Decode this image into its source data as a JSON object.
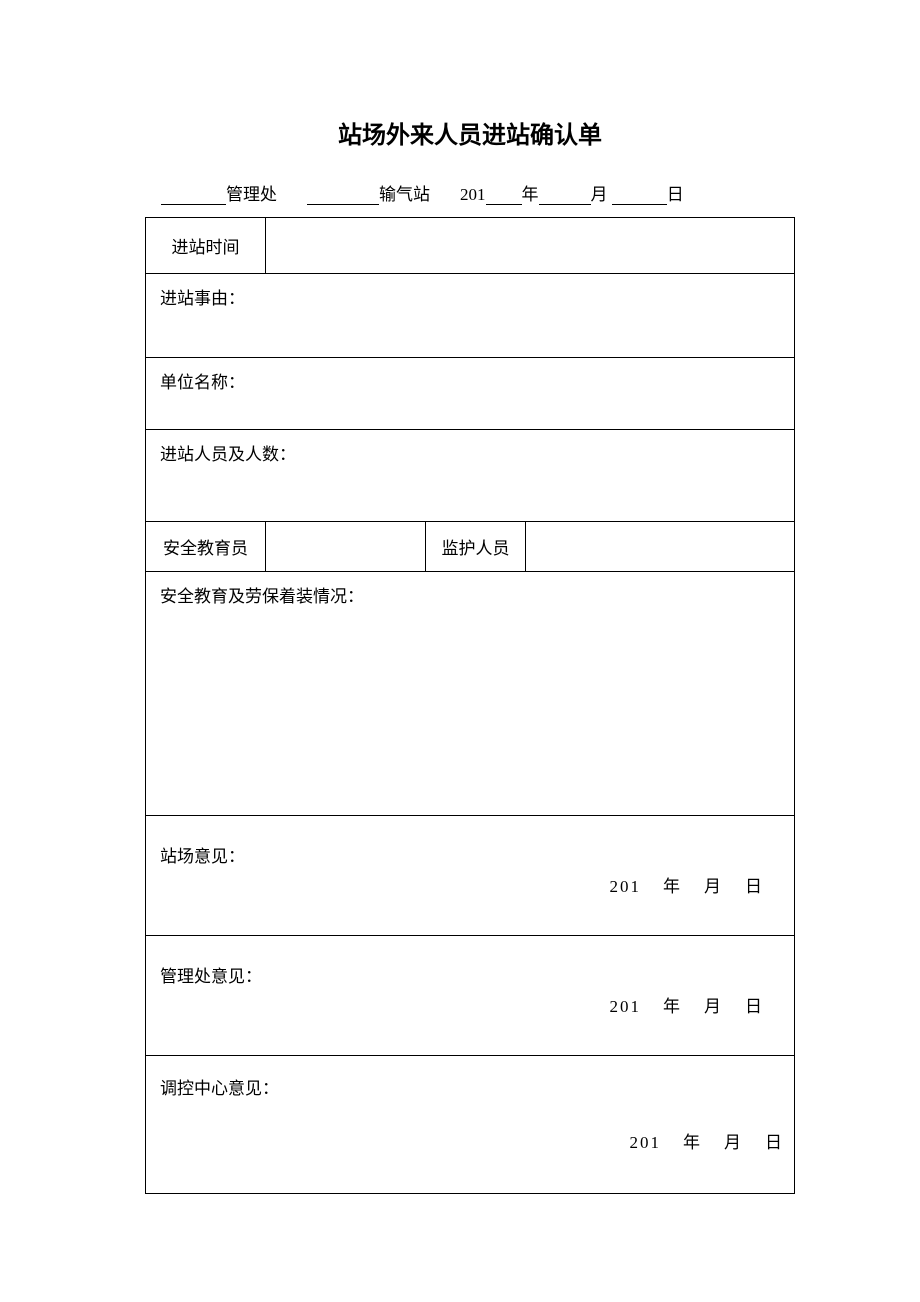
{
  "title": "站场外来人员进站确认单",
  "header": {
    "management": "管理处",
    "station": "输气站",
    "year_prefix": "201",
    "year": "年",
    "month": "月",
    "day": "日"
  },
  "labels": {
    "entry_time": "进站时间",
    "entry_reason": "进站事由：",
    "unit_name": "单位名称：",
    "personnel": "进站人员及人数：",
    "safety_educator": "安全教育员",
    "supervisor": "监护人员",
    "safety_education": "安全教育及劳保着装情况：",
    "station_opinion": "站场意见：",
    "management_opinion": "管理处意见：",
    "control_center_opinion": "调控中心意见："
  },
  "date_parts": {
    "prefix": "201",
    "year": "年",
    "month": "月",
    "day": "日"
  }
}
